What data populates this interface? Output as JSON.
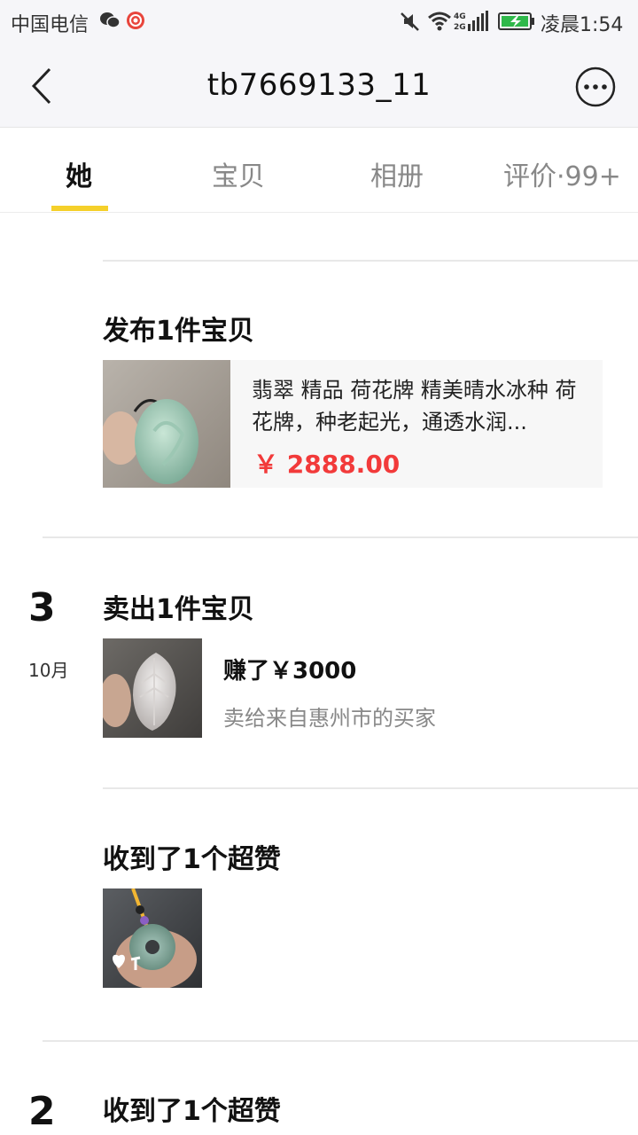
{
  "status_bar": {
    "carrier": "中国电信",
    "network": "4G 2G",
    "time": "凌晨1:54",
    "icons": [
      "wechat-icon",
      "app-notification-icon",
      "mute-icon",
      "wifi-icon",
      "signal-icon",
      "battery-charging-icon"
    ]
  },
  "nav": {
    "title": "tb7669133_11",
    "back_icon": "chevron-left-icon",
    "more_icon": "more-dots-icon"
  },
  "tabs": [
    {
      "label": "她",
      "active": true
    },
    {
      "label": "宝贝",
      "active": false
    },
    {
      "label": "相册",
      "active": false
    },
    {
      "label": "评价·99+",
      "active": false
    }
  ],
  "accent_color": "#f5d02a",
  "price_color": "#f23a3a",
  "feed": {
    "publish": {
      "title": "发布1件宝贝",
      "item_desc": "翡翠 精品 荷花牌 精美晴水冰种 荷花牌，种老起光，通透水润...",
      "price": "￥ 2888.00"
    },
    "day3": {
      "day": "3",
      "month": "10月",
      "sold": {
        "title": "卖出1件宝贝",
        "earned": "赚了￥3000",
        "buyer": "卖给来自惠州市的买家"
      },
      "likes": {
        "title": "收到了1个超赞"
      }
    },
    "day2": {
      "day": "2",
      "likes": {
        "title": "收到了1个超赞"
      }
    }
  }
}
